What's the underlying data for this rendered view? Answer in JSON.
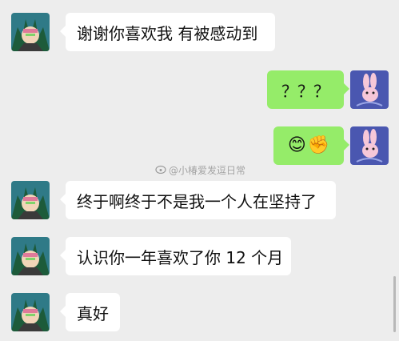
{
  "messages": [
    {
      "side": "left",
      "text": "谢谢你喜欢我 有被感动到"
    },
    {
      "side": "right",
      "text": "？？？"
    },
    {
      "side": "right",
      "emojis": [
        "😊",
        "✊"
      ]
    },
    {
      "side": "left",
      "text": "终于啊终于不是我一个人在坚持了"
    },
    {
      "side": "left",
      "text": "认识你一年喜欢了你 12 个月"
    },
    {
      "side": "left",
      "text": "真好"
    }
  ],
  "watermark": {
    "text": "@小椿爱发逗日常",
    "icon": "weibo-logo-icon"
  },
  "colors": {
    "background": "#ededed",
    "sent_bubble": "#95ec69",
    "received_bubble": "#ffffff"
  }
}
